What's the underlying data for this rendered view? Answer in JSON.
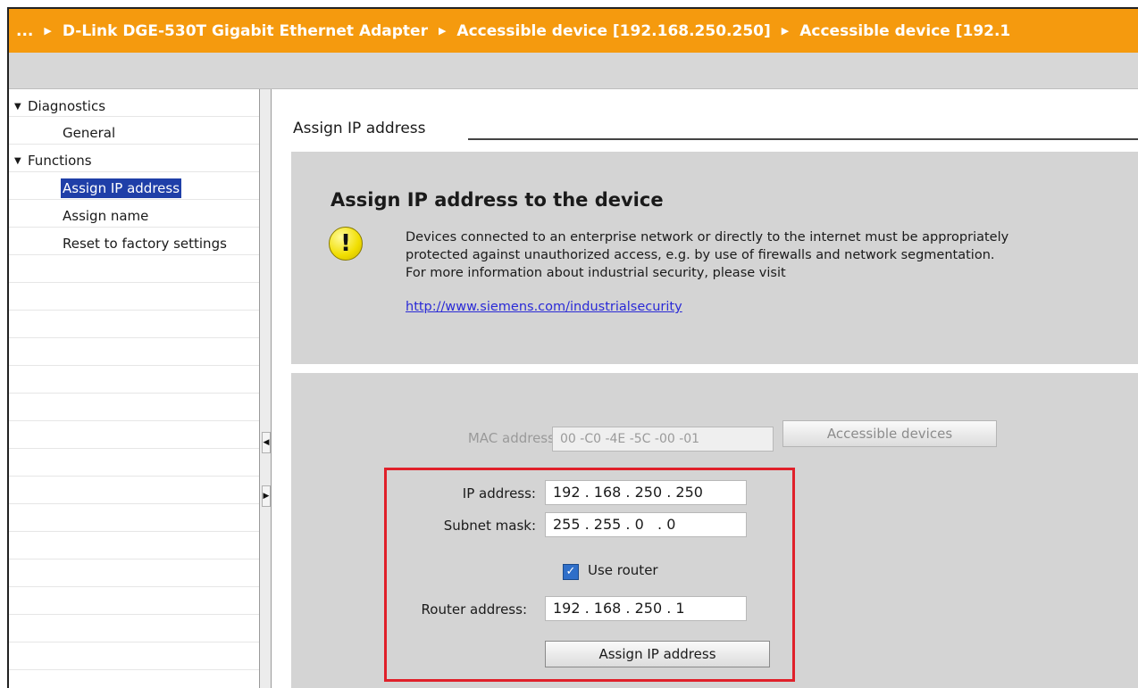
{
  "breadcrumb": {
    "ellipsis": "...",
    "items": [
      "D-Link DGE-530T Gigabit Ethernet Adapter",
      "Accessible device [192.168.250.250]",
      "Accessible device [192.1"
    ],
    "separator_icon": "triangle-right-icon"
  },
  "nav": {
    "groups": [
      {
        "label": "Diagnostics",
        "items": [
          "General"
        ]
      },
      {
        "label": "Functions",
        "items": [
          "Assign IP address",
          "Assign name",
          "Reset to factory settings"
        ]
      }
    ],
    "selected": "Assign IP address"
  },
  "section": {
    "title": "Assign IP address"
  },
  "info_panel": {
    "heading": "Assign IP address to the device",
    "warning_icon": "warning-icon",
    "text_lines": [
      "Devices connected to an enterprise network or directly to the internet must be appropriately",
      "protected against unauthorized access, e.g. by use of firewalls and network segmentation.",
      "For more information about industrial security, please visit"
    ],
    "link": "http://www.siemens.com/industrialsecurity"
  },
  "form": {
    "mac_label": "MAC address:",
    "mac_value": "00 -C0 -4E -5C -00 -01",
    "accessible_devices_button": "Accessible devices",
    "ip_label": "IP address:",
    "ip_value": "192 . 168 . 250 . 250",
    "subnet_label": "Subnet mask:",
    "subnet_value": "255 . 255 . 0   . 0",
    "use_router_label": "Use router",
    "use_router_checked": true,
    "router_label": "Router address:",
    "router_value": "192 . 168 . 250 . 1",
    "assign_button": "Assign IP address"
  },
  "colors": {
    "breadcrumb_bg": "#f59a0e",
    "selected_bg": "#1f3fa8",
    "highlight_border": "#e0202a",
    "panel_bg": "#d4d4d4"
  }
}
